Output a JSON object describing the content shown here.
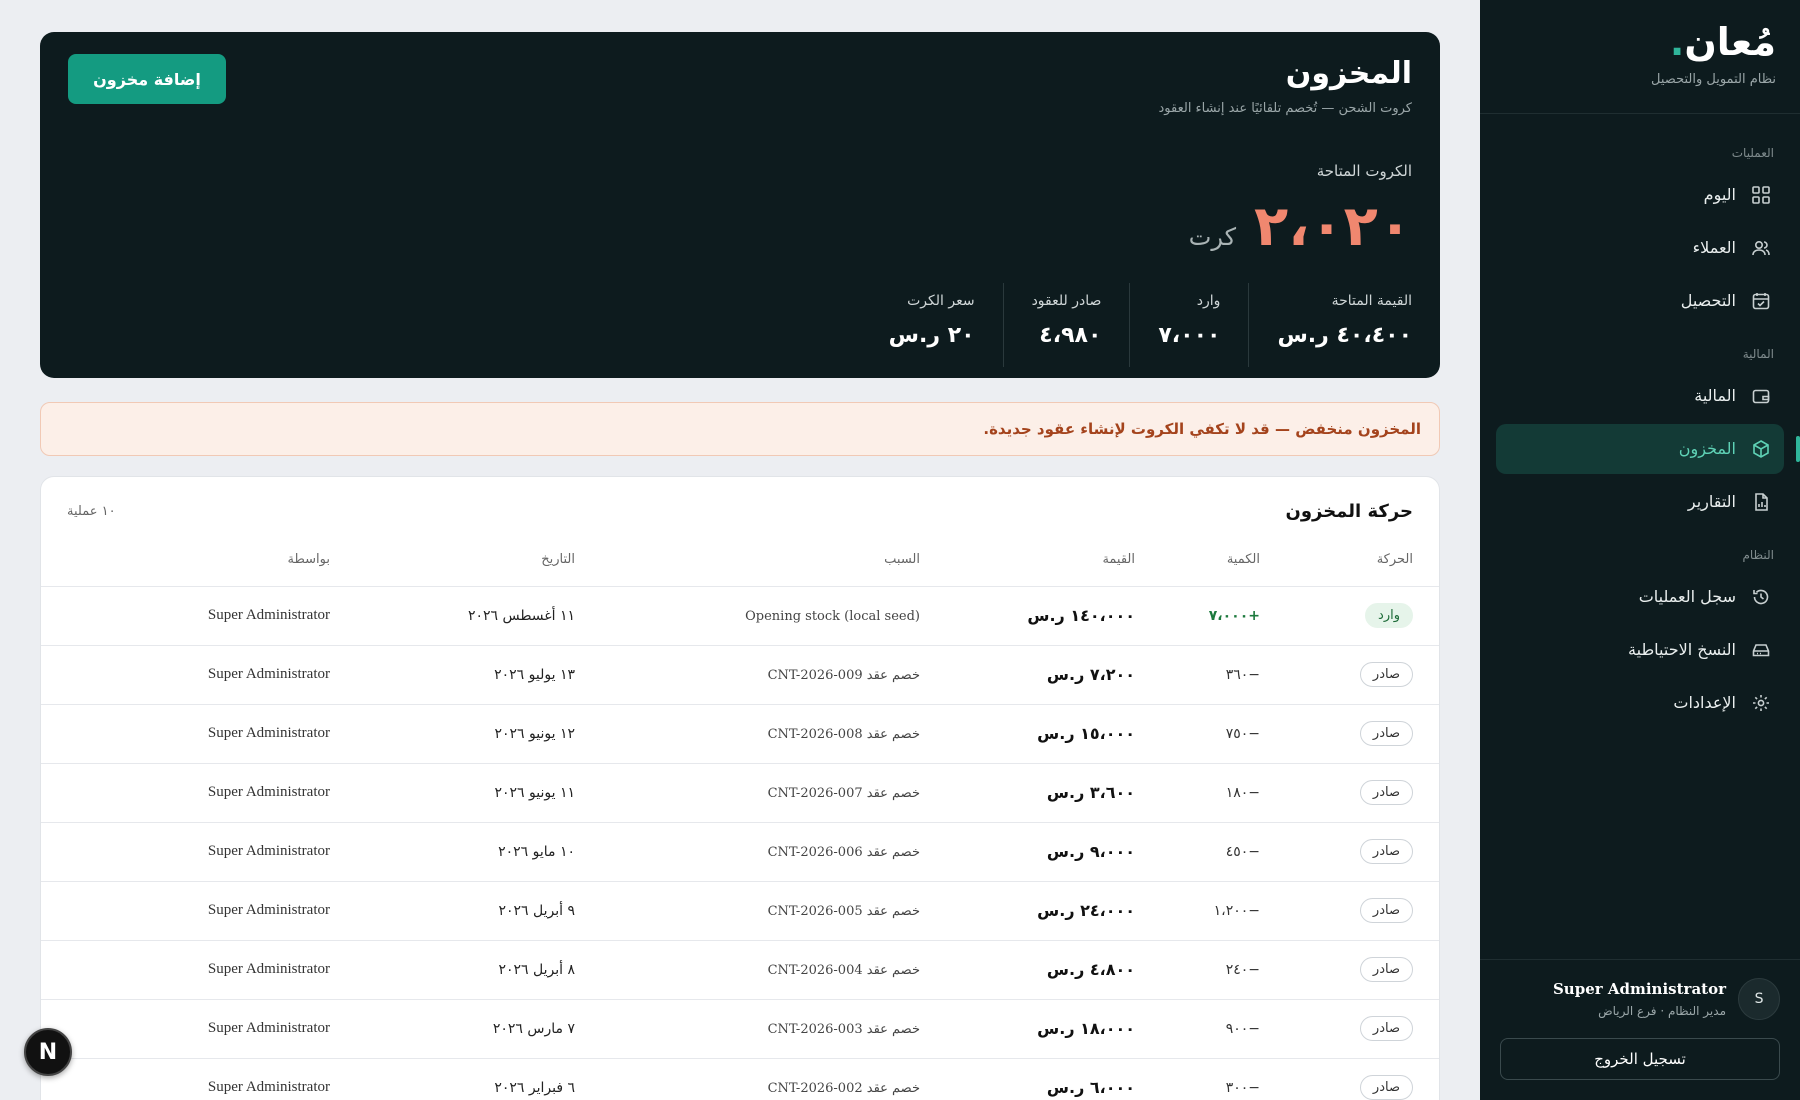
{
  "sidebar": {
    "brand_name": "مُعان",
    "brand_dot": ".",
    "brand_tagline": "نظام التمويل والتحصيل",
    "sections": [
      {
        "label": "العمليات",
        "items": [
          {
            "label": "اليوم",
            "icon": "grid-icon"
          },
          {
            "label": "العملاء",
            "icon": "users-icon"
          },
          {
            "label": "التحصيل",
            "icon": "calendar-check-icon"
          }
        ]
      },
      {
        "label": "المالية",
        "items": [
          {
            "label": "المالية",
            "icon": "wallet-icon"
          },
          {
            "label": "المخزون",
            "icon": "box-icon",
            "active": true
          },
          {
            "label": "التقارير",
            "icon": "report-icon"
          }
        ]
      },
      {
        "label": "النظام",
        "items": [
          {
            "label": "سجل العمليات",
            "icon": "history-icon"
          },
          {
            "label": "النسخ الاحتياطية",
            "icon": "drive-icon"
          },
          {
            "label": "الإعدادات",
            "icon": "gear-icon"
          }
        ]
      }
    ],
    "user": {
      "initial": "S",
      "name": "Super Administrator",
      "role": "مدير النظام · فرع الرياض"
    },
    "logout_label": "تسجيل الخروج"
  },
  "hero": {
    "title": "المخزون",
    "subtitle": "كروت الشحن — تُخصم تلقائيًا عند إنشاء العقود",
    "add_button": "إضافة مخزون",
    "available_label": "الكروت المتاحة",
    "available_value": "٢،٠٢٠",
    "available_unit": "كرت",
    "stats": [
      {
        "label": "القيمة المتاحة",
        "value": "٤٠،٤٠٠ ر.س"
      },
      {
        "label": "وارد",
        "value": "٧،٠٠٠"
      },
      {
        "label": "صادر للعقود",
        "value": "٤،٩٨٠"
      },
      {
        "label": "سعر الكرت",
        "value": "٢٠ ر.س"
      }
    ]
  },
  "alert": {
    "text": "المخزون منخفض — قد لا تكفي الكروت لإنشاء عقود جديدة."
  },
  "movements": {
    "title": "حركة المخزون",
    "count": "١٠ عملية",
    "columns": [
      "الحركة",
      "الكمية",
      "القيمة",
      "السبب",
      "التاريخ",
      "بواسطة"
    ],
    "rows": [
      {
        "type": "وارد",
        "kind": "in",
        "qty": "+٧،٠٠٠",
        "value": "١٤٠،٠٠٠ ر.س",
        "reason": "Opening stock (local seed)",
        "date": "١١ أغسطس ٢٠٢٦",
        "by": "Super Administrator"
      },
      {
        "type": "صادر",
        "kind": "out",
        "qty": "−٣٦٠",
        "value": "٧،٢٠٠ ر.س",
        "reason": "خصم عقد CNT-2026-009",
        "date": "١٣ يوليو ٢٠٢٦",
        "by": "Super Administrator"
      },
      {
        "type": "صادر",
        "kind": "out",
        "qty": "−٧٥٠",
        "value": "١٥،٠٠٠ ر.س",
        "reason": "خصم عقد CNT-2026-008",
        "date": "١٢ يونيو ٢٠٢٦",
        "by": "Super Administrator"
      },
      {
        "type": "صادر",
        "kind": "out",
        "qty": "−١٨٠",
        "value": "٣،٦٠٠ ر.س",
        "reason": "خصم عقد CNT-2026-007",
        "date": "١١ يونيو ٢٠٢٦",
        "by": "Super Administrator"
      },
      {
        "type": "صادر",
        "kind": "out",
        "qty": "−٤٥٠",
        "value": "٩،٠٠٠ ر.س",
        "reason": "خصم عقد CNT-2026-006",
        "date": "١٠ مايو ٢٠٢٦",
        "by": "Super Administrator"
      },
      {
        "type": "صادر",
        "kind": "out",
        "qty": "−١،٢٠٠",
        "value": "٢٤،٠٠٠ ر.س",
        "reason": "خصم عقد CNT-2026-005",
        "date": "٩ أبريل ٢٠٢٦",
        "by": "Super Administrator"
      },
      {
        "type": "صادر",
        "kind": "out",
        "qty": "−٢٤٠",
        "value": "٤،٨٠٠ ر.س",
        "reason": "خصم عقد CNT-2026-004",
        "date": "٨ أبريل ٢٠٢٦",
        "by": "Super Administrator"
      },
      {
        "type": "صادر",
        "kind": "out",
        "qty": "−٩٠٠",
        "value": "١٨،٠٠٠ ر.س",
        "reason": "خصم عقد CNT-2026-003",
        "date": "٧ مارس ٢٠٢٦",
        "by": "Super Administrator"
      },
      {
        "type": "صادر",
        "kind": "out",
        "qty": "−٣٠٠",
        "value": "٦،٠٠٠ ر.س",
        "reason": "خصم عقد CNT-2026-002",
        "date": "٦ فبراير ٢٠٢٦",
        "by": "Super Administrator"
      }
    ]
  },
  "dev_badge": "N"
}
